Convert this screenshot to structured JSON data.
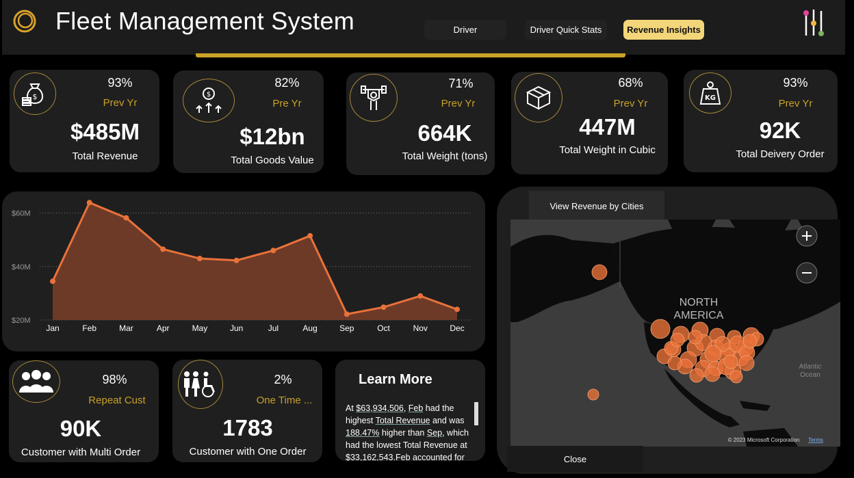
{
  "header": {
    "title": "Fleet Management System",
    "nav": [
      {
        "label": "Driver",
        "active": false
      },
      {
        "label": "Driver Quick Stats",
        "active": false
      },
      {
        "label": "Revenue Insights",
        "active": true
      }
    ],
    "accent": "#c9a227"
  },
  "kpis": [
    {
      "pct": "93%",
      "prev": "Prev Yr",
      "value": "$485M",
      "label": "Total Revenue",
      "icon": "money-bag-icon"
    },
    {
      "pct": "82%",
      "prev": "Pre Yr",
      "value": "$12bn",
      "label": "Total Goods Value",
      "icon": "coin-growth-icon"
    },
    {
      "pct": "71%",
      "prev": "Prev Yr",
      "value": "664K",
      "label": "Total Weight (tons)",
      "icon": "weightlifting-icon"
    },
    {
      "pct": "68%",
      "prev": "Prev Yr",
      "value": "447M",
      "label": "Total Weight in Cubic",
      "icon": "boxes-icon"
    },
    {
      "pct": "93%",
      "prev": "Prev Yr",
      "value": "92K",
      "label": "Total Deivery Order",
      "icon": "kg-weight-icon"
    }
  ],
  "customers": [
    {
      "pct": "98%",
      "prev": "Repeat Cust",
      "value": "90K",
      "label": "Customer with Multi Order",
      "icon": "group-icon"
    },
    {
      "pct": "2%",
      "prev": "One Time ...",
      "value": "1783",
      "label": "Customer with One Order",
      "icon": "people-accessibility-icon"
    }
  ],
  "chart_data": {
    "type": "area",
    "categories": [
      "Jan",
      "Feb",
      "Mar",
      "Apr",
      "May",
      "Jun",
      "Jul",
      "Aug",
      "Sep",
      "Oct",
      "Nov",
      "Dec"
    ],
    "values": [
      34.5,
      63.9,
      58.2,
      46.5,
      43.0,
      42.3,
      46.0,
      51.5,
      22.2,
      24.8,
      29.0,
      24.0
    ],
    "y_ticks": [
      "$20M",
      "$40M",
      "$60M"
    ],
    "y_tick_values": [
      20,
      40,
      60
    ],
    "ylim": [
      20,
      65
    ],
    "grid": true,
    "color": "#e8723a",
    "fill": "#6e3a28"
  },
  "map": {
    "tab_label": "View Revenue by Cities",
    "region_label_1": "NORTH",
    "region_label_2": "AMERICA",
    "ocean_label_1": "Atlantic",
    "ocean_label_2": "Ocean",
    "copyright": "© 2023 Microsoft Corporation",
    "terms": "Terms",
    "close_label": "Close",
    "bubble_color": "#e8723a"
  },
  "learn_more": {
    "title": "Learn More",
    "t1": "At ",
    "t2": "$63,934,506",
    "t3": ", ",
    "t4": "Feb",
    "t5": " had the highest ",
    "t6": "Total Revenue",
    "t7": " and was ",
    "t8": "188.47%",
    "t9": " higher than ",
    "t10": "Sep",
    "t11": ", which had the lowest Total Revenue at $33,162,543.Feb accounted for"
  }
}
